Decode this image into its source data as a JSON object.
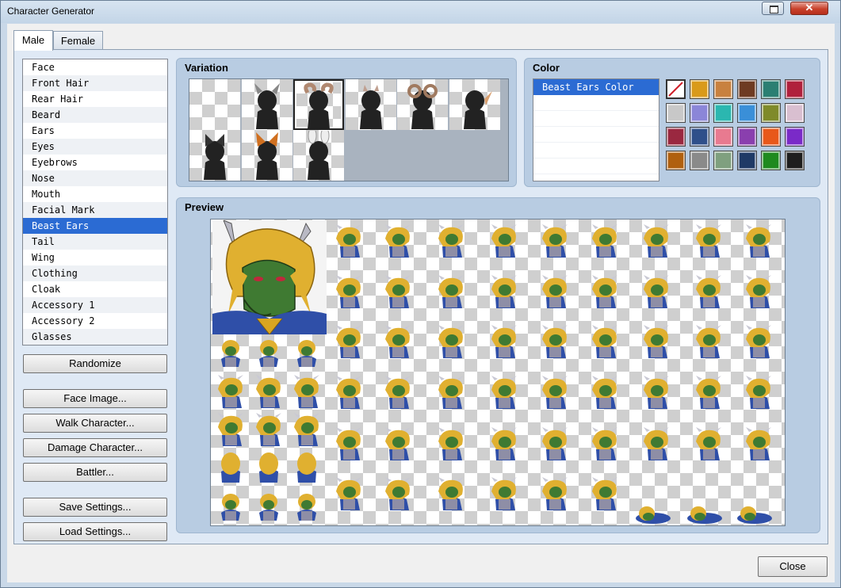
{
  "window": {
    "title": "Character Generator"
  },
  "tabs": [
    {
      "label": "Male"
    },
    {
      "label": "Female"
    }
  ],
  "parts": [
    {
      "label": "Face"
    },
    {
      "label": "Front Hair"
    },
    {
      "label": "Rear Hair"
    },
    {
      "label": "Beard"
    },
    {
      "label": "Ears"
    },
    {
      "label": "Eyes"
    },
    {
      "label": "Eyebrows"
    },
    {
      "label": "Nose"
    },
    {
      "label": "Mouth"
    },
    {
      "label": "Facial Mark"
    },
    {
      "label": "Beast Ears"
    },
    {
      "label": "Tail"
    },
    {
      "label": "Wing"
    },
    {
      "label": "Clothing"
    },
    {
      "label": "Cloak"
    },
    {
      "label": "Accessory 1"
    },
    {
      "label": "Accessory 2"
    },
    {
      "label": "Glasses"
    }
  ],
  "selected_part": "Beast Ears",
  "buttons": {
    "randomize": "Randomize",
    "face_image": "Face Image...",
    "walk_character": "Walk Character...",
    "damage_character": "Damage Character...",
    "battler": "Battler...",
    "save_settings": "Save Settings...",
    "load_settings": "Load Settings...",
    "close": "Close"
  },
  "variation": {
    "title": "Variation",
    "items": [
      {
        "icon": "empty-variation-icon"
      },
      {
        "icon": "horned-head-silhouette-icon"
      },
      {
        "icon": "curled-horn-silhouette-icon",
        "selected": true
      },
      {
        "icon": "small-horn-silhouette-icon"
      },
      {
        "icon": "ram-horn-silhouette-icon"
      },
      {
        "icon": "elf-ear-silhouette-icon"
      },
      {
        "icon": "cat-ear-silhouette-icon"
      },
      {
        "icon": "fox-ear-silhouette-icon"
      },
      {
        "icon": "rabbit-ear-silhouette-icon"
      }
    ]
  },
  "color": {
    "title": "Color",
    "items": [
      {
        "label": "Beast Ears Color"
      }
    ],
    "swatches": [
      {
        "name": "no-color",
        "hex": "#ffffff"
      },
      {
        "name": "gold",
        "hex": "#d99a1a"
      },
      {
        "name": "tan",
        "hex": "#c8813f"
      },
      {
        "name": "brown",
        "hex": "#6e3b22"
      },
      {
        "name": "teal",
        "hex": "#2b7f72"
      },
      {
        "name": "crimson",
        "hex": "#b0203c"
      },
      {
        "name": "silver",
        "hex": "#c8c8c8"
      },
      {
        "name": "lavender",
        "hex": "#8b86d8"
      },
      {
        "name": "aqua",
        "hex": "#2bb7b0"
      },
      {
        "name": "sky-blue",
        "hex": "#3a8fd8"
      },
      {
        "name": "olive",
        "hex": "#7f8a2a"
      },
      {
        "name": "pale-pink",
        "hex": "#d9bfd0"
      },
      {
        "name": "wine",
        "hex": "#9a2840"
      },
      {
        "name": "navy-blue",
        "hex": "#2f4f8a"
      },
      {
        "name": "pink",
        "hex": "#e87a90"
      },
      {
        "name": "purple",
        "hex": "#8a3fae"
      },
      {
        "name": "orange",
        "hex": "#e8581a"
      },
      {
        "name": "violet",
        "hex": "#7a2ac8"
      },
      {
        "name": "amber",
        "hex": "#b0600f"
      },
      {
        "name": "gray",
        "hex": "#8a8a8a"
      },
      {
        "name": "sage",
        "hex": "#7fa07f"
      },
      {
        "name": "midnight-blue",
        "hex": "#1f3a66"
      },
      {
        "name": "green",
        "hex": "#1f8a1f"
      },
      {
        "name": "black",
        "hex": "#1e1e1e"
      }
    ]
  },
  "preview": {
    "title": "Preview",
    "face_icon": "dragon-face-portrait-icon",
    "sprite_icon": "dragon-warrior-sprite-icon",
    "accent_colors": {
      "hair": "#e0b030",
      "skin": "#3f7a32",
      "cloak": "#2f4fa8",
      "armor": "#8e8ea6"
    }
  }
}
